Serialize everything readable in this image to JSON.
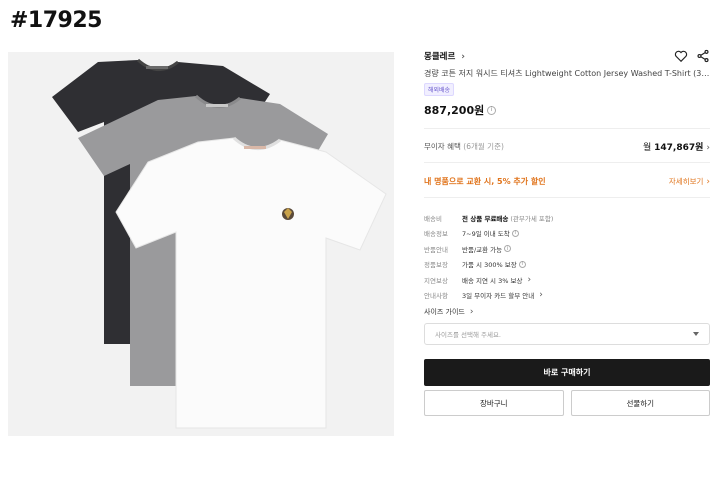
{
  "page_id": "#17925",
  "product": {
    "brand": "몽클레르",
    "title": "경량 코튼 저지 워시드 티셔츠 Lightweight Cotton Jersey Washed T-Shirt (3-P...",
    "badge": "해외배송",
    "price": "887,200원"
  },
  "interest_free": {
    "label": "무이자 혜택",
    "sub": "(6개월 기준)",
    "prefix": "월",
    "amount": "147,867원"
  },
  "promo": {
    "text": "내 명품으로 교환 시, 5% 추가 할인",
    "link": "자세히보기"
  },
  "specs": [
    {
      "label": "배송비",
      "value": "전 상품 무료배송",
      "sub": "(관부가세 포함)"
    },
    {
      "label": "배송정보",
      "value": "7~9일 이내 도착"
    },
    {
      "label": "반품안내",
      "value": "반품/교환 가능"
    },
    {
      "label": "정품보장",
      "value": "가품 시 300% 보장"
    },
    {
      "label": "지연보상",
      "value": "배송 지연 시 3% 보상"
    },
    {
      "label": "안내사항",
      "value": "3일 무이자 카드 할부 안내"
    }
  ],
  "size_guide": "사이즈 가이드",
  "size_select_placeholder": "사이즈를 선택해 주세요.",
  "buttons": {
    "buy_now": "바로 구매하기",
    "cart": "장바구니",
    "gift": "선물하기"
  },
  "icons": [
    "heart-icon",
    "share-icon",
    "chevron-right-icon",
    "info-icon",
    "caret-down-icon"
  ],
  "colors": {
    "promo": "#e0741c",
    "buy_bg": "#1a1a1a",
    "badge": "#6a5acd"
  }
}
